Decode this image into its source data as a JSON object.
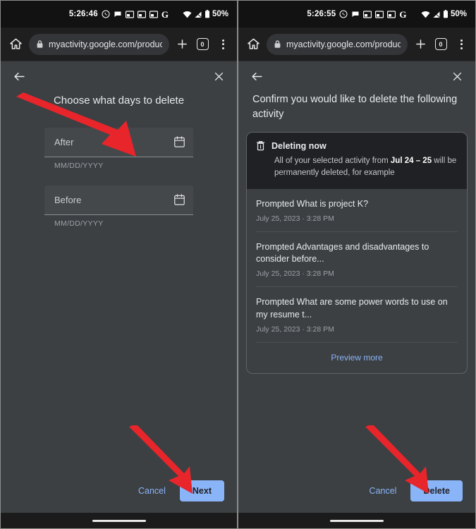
{
  "panels": [
    {
      "id": "left",
      "status": {
        "time": "5:26:46",
        "battery": "50%",
        "icons": [
          "whatsapp-icon",
          "chat-bubble-icon",
          "screenshot-icon",
          "screenshot-icon",
          "screenshot-icon",
          "google-g-icon"
        ],
        "right_icons": [
          "wifi-icon",
          "signal-icon",
          "battery-icon"
        ]
      },
      "browser": {
        "home_icon": "home-icon",
        "lock_icon": "lock-icon",
        "url": "myactivity.google.com/product",
        "new_tab_icon": "plus-icon",
        "tab_count": "0",
        "menu_icon": "overflow-menu-icon"
      },
      "dialog": {
        "back_icon": "back-arrow-icon",
        "close_icon": "close-icon",
        "title": "Choose what days to delete",
        "title_align": "center",
        "fields": [
          {
            "label": "After",
            "helper": "MM/DD/YYYY",
            "icon": "calendar-icon"
          },
          {
            "label": "Before",
            "helper": "MM/DD/YYYY",
            "icon": "calendar-icon"
          }
        ],
        "cancel_label": "Cancel",
        "primary_label": "Next"
      }
    },
    {
      "id": "right",
      "status": {
        "time": "5:26:55",
        "battery": "50%"
      },
      "browser": {
        "url": "myactivity.google.com/product",
        "tab_count": "0"
      },
      "dialog": {
        "back_icon": "back-arrow-icon",
        "close_icon": "close-icon",
        "title": "Confirm you would like to delete the following activity",
        "title_align": "left",
        "banner": {
          "icon": "trash-icon",
          "heading": "Deleting now",
          "body_before": "All of your selected activity from ",
          "body_bold": "Jul 24 – 25",
          "body_after": " will be permanently deleted, for example"
        },
        "activities": [
          {
            "title": "Prompted What is project K?",
            "meta": "July 25, 2023 · 3:28 PM"
          },
          {
            "title": "Prompted Advantages and disadvantages to consider before...",
            "meta": "July 25, 2023 · 3:28 PM"
          },
          {
            "title": "Prompted What are some power words to use on my resume t...",
            "meta": "July 25, 2023 · 3:28 PM"
          }
        ],
        "preview_more_label": "Preview more",
        "cancel_label": "Cancel",
        "primary_label": "Delete"
      }
    }
  ],
  "colors": {
    "accent": "#8ab4f8",
    "page_bg": "#3c4043",
    "banner_bg": "#202124",
    "status_bg": "#121212",
    "toolbar_bg": "#1f1f1f",
    "annotation_red": "#e8252a"
  },
  "annotations": [
    {
      "name": "arrow-to-after-field",
      "target": "after-field"
    },
    {
      "name": "arrow-to-next-button",
      "target": "next-button"
    },
    {
      "name": "arrow-to-delete-button",
      "target": "delete-button"
    }
  ]
}
